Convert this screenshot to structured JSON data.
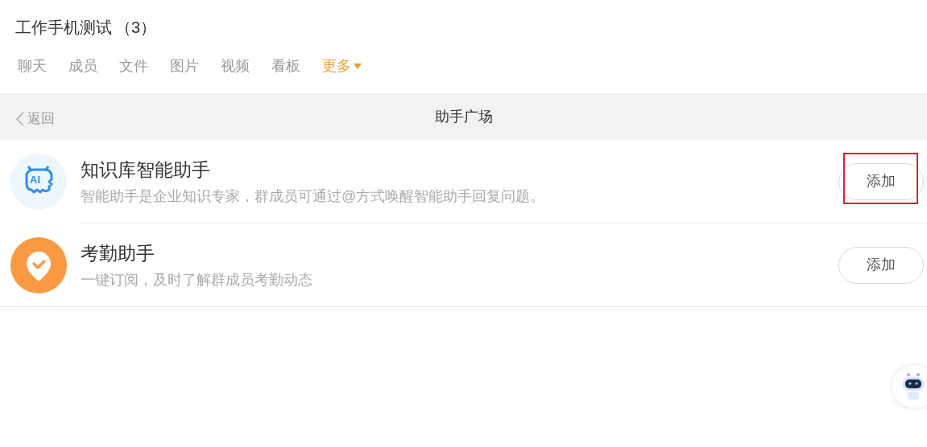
{
  "header": {
    "title": "工作手机测试",
    "count": "（3）"
  },
  "tabs": [
    {
      "label": "聊天",
      "selected": false
    },
    {
      "label": "成员",
      "selected": false
    },
    {
      "label": "文件",
      "selected": false
    },
    {
      "label": "图片",
      "selected": false
    },
    {
      "label": "视频",
      "selected": false
    },
    {
      "label": "看板",
      "selected": false
    },
    {
      "label": "更多",
      "selected": true,
      "dropdown": true
    }
  ],
  "nav": {
    "back": "返回",
    "title": "助手广场"
  },
  "assistants": [
    {
      "kind": "ai",
      "icon_text": "AI",
      "name": "知识库智能助手",
      "description": "智能助手是企业知识专家，群成员可通过@方式唤醒智能助手回复问题。",
      "button": "添加",
      "highlighted": true
    },
    {
      "kind": "attendance",
      "name": "考勤助手",
      "description": "一键订阅，及时了解群成员考勤动态",
      "button": "添加",
      "highlighted": false
    }
  ]
}
